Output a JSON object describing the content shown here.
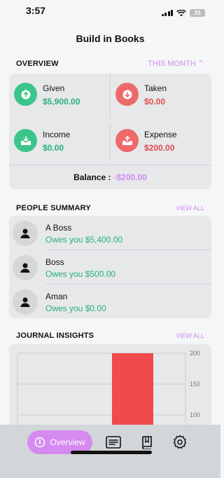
{
  "status": {
    "time": "3:57",
    "battery": "33"
  },
  "header": {
    "title": "Build in Books"
  },
  "overview": {
    "title": "OVERVIEW",
    "period": "THIS MONTH ⌃",
    "given": {
      "label": "Given",
      "value": "$5,900.00"
    },
    "taken": {
      "label": "Taken",
      "value": "$0.00"
    },
    "income": {
      "label": "Income",
      "value": "$0.00"
    },
    "expense": {
      "label": "Expense",
      "value": "$200.00"
    },
    "balance_label": "Balance :",
    "balance_value": "-$200.00"
  },
  "people": {
    "title": "PEOPLE SUMMARY",
    "view_all": "VIEW ALL",
    "items": [
      {
        "name": "A Boss",
        "owes": "Owes you $5,400.00"
      },
      {
        "name": "Boss",
        "owes": "Owes you $500.00"
      },
      {
        "name": "Aman",
        "owes": "Owes you $0.00"
      }
    ]
  },
  "journal": {
    "title": "JOURNAL INSIGHTS",
    "view_all": "VIEW ALL"
  },
  "chart_data": {
    "type": "bar",
    "categories": [
      ""
    ],
    "series": [
      {
        "values": [
          200
        ]
      }
    ],
    "yticks": [
      "200",
      "150",
      "100"
    ],
    "ylim": [
      0,
      200
    ],
    "bar_color": "#f04a4a"
  },
  "tabbar": {
    "active_label": "Overview"
  },
  "colors": {
    "accent": "#d58af0",
    "positive": "#27b27a",
    "negative": "#e24d4d"
  }
}
